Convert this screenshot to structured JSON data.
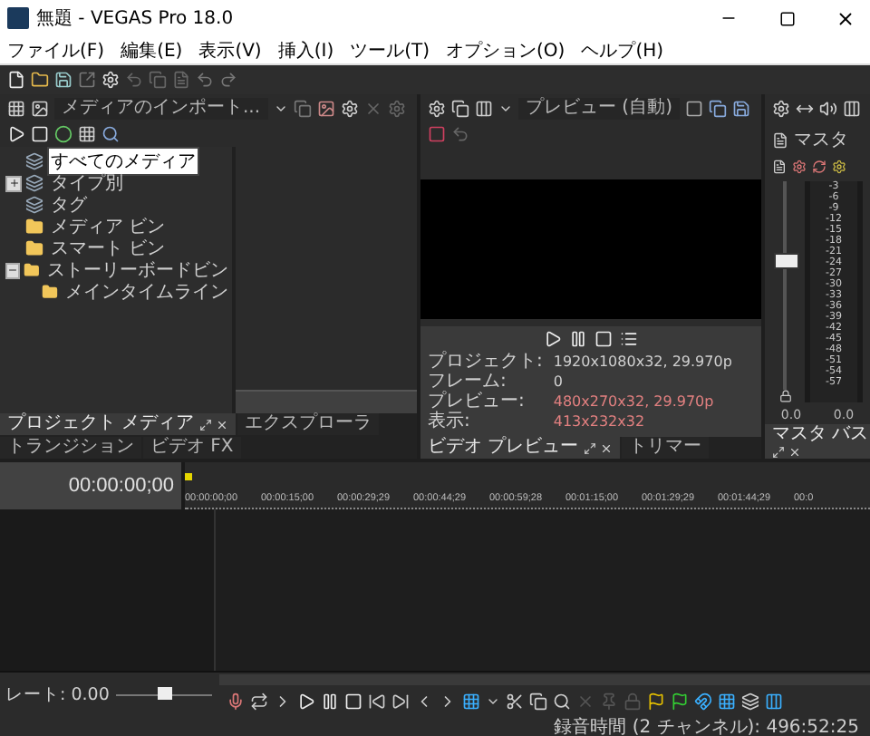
{
  "window": {
    "title": "無題 - VEGAS Pro 18.0"
  },
  "menu": [
    "ファイル(F)",
    "編集(E)",
    "表示(V)",
    "挿入(I)",
    "ツール(T)",
    "オプション(O)",
    "ヘルプ(H)"
  ],
  "media_panel": {
    "import_button": "メディアのインポート...",
    "tree": [
      {
        "label": "すべてのメディア",
        "kind": "collection",
        "selected": true
      },
      {
        "label": "タイプ別",
        "kind": "collection",
        "selected": false,
        "expanded": false
      },
      {
        "label": "タグ",
        "kind": "collection",
        "selected": false
      },
      {
        "label": "メディア ビン",
        "kind": "bin",
        "selected": false
      },
      {
        "label": "スマート ビン",
        "kind": "bin",
        "selected": false
      },
      {
        "label": "ストーリーボードビン",
        "kind": "bin",
        "selected": false,
        "expanded": true,
        "children": [
          {
            "label": "メインタイムライン",
            "kind": "bin",
            "selected": false
          }
        ]
      }
    ],
    "tabs": [
      {
        "label": "プロジェクト メディア",
        "selected": true
      },
      {
        "label": "エクスプローラ",
        "selected": false
      },
      {
        "label": "トランジション",
        "selected": false
      },
      {
        "label": "ビデオ FX",
        "selected": false
      }
    ]
  },
  "preview_panel": {
    "mode": "プレビュー (自動)",
    "info": [
      {
        "label": "プロジェクト:",
        "value": "1920x1080x32, 29.970p",
        "highlight": false
      },
      {
        "label": "フレーム:",
        "value": "0",
        "highlight": false
      },
      {
        "label": "プレビュー:",
        "value": "480x270x32, 29.970p",
        "highlight": true
      },
      {
        "label": "表示:",
        "value": "413x232x32",
        "highlight": true
      }
    ],
    "tabs": [
      {
        "label": "ビデオ プレビュー",
        "selected": true
      },
      {
        "label": "トリマー",
        "selected": false
      }
    ]
  },
  "master_panel": {
    "title": "マスタ",
    "fader": {
      "level": 0.62
    },
    "scale": [
      "-3",
      "-6",
      "-9",
      "-12",
      "-15",
      "-18",
      "-21",
      "-24",
      "-27",
      "-30",
      "-33",
      "-36",
      "-39",
      "-42",
      "-45",
      "-48",
      "-51",
      "-54",
      "-57"
    ],
    "readings": [
      "0.0",
      "0.0"
    ],
    "tabs": [
      {
        "label": "マスタ バス",
        "selected": true
      }
    ]
  },
  "timeline": {
    "time": "00:00:00;00",
    "ruler": [
      "00:00:00;00",
      "00:00:15;00",
      "00:00:29;29",
      "00:00:44;29",
      "00:00:59;28",
      "00:01:15;00",
      "00:01:29;29",
      "00:01:44;29",
      "00:0"
    ]
  },
  "transport": {
    "rate": "レート: 0.00",
    "rate_slider": {
      "level": 0.5
    }
  },
  "status_bar": {
    "text": "録音時間 (2 チャンネル): 496:52:25"
  }
}
